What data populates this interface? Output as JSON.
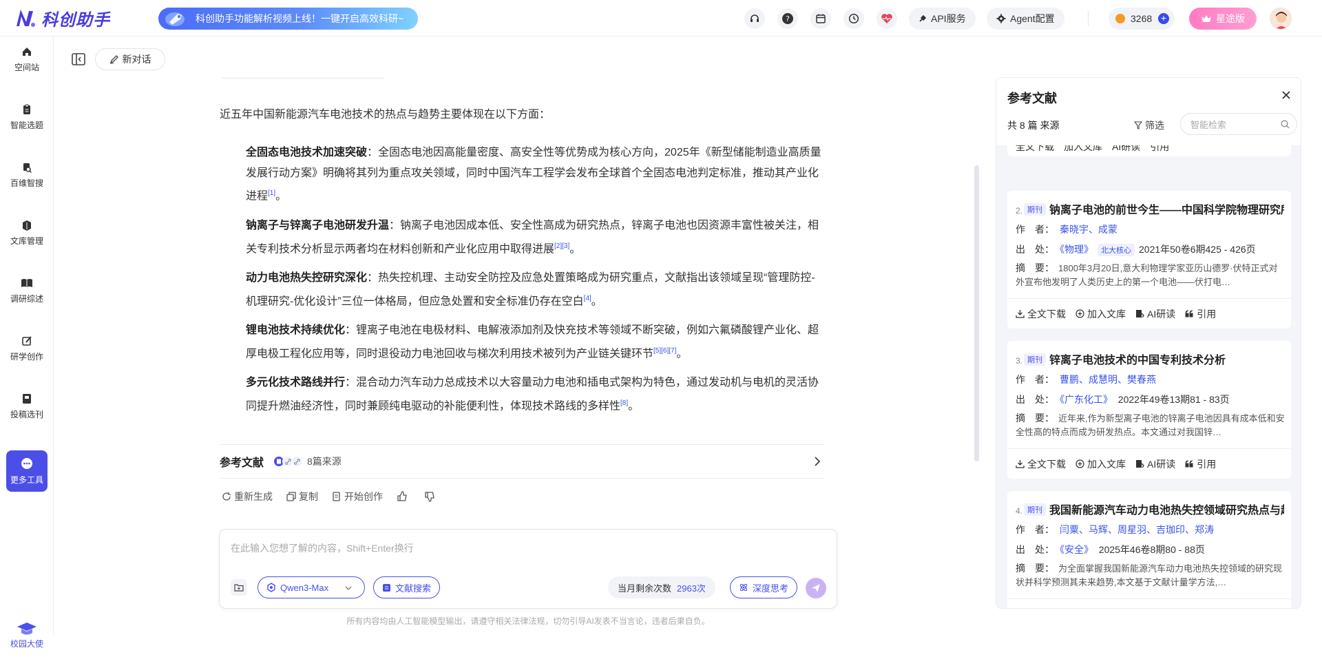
{
  "app": {
    "name": "科创助手"
  },
  "banner": {
    "text": "科创助手功能解析视频上线！一键开启高效科研~"
  },
  "header": {
    "api_label": "API服务",
    "agent_label": "Agent配置",
    "coins": "3268",
    "vip_label": "星途版",
    "plus_label": "+"
  },
  "sidebar": {
    "items": [
      {
        "label": "空间站",
        "icon": "home-icon"
      },
      {
        "label": "智能选题",
        "icon": "clipboard-icon"
      },
      {
        "label": "百维智搜",
        "icon": "search-icon"
      },
      {
        "label": "文库管理",
        "icon": "library-icon"
      },
      {
        "label": "调研综述",
        "icon": "book-icon"
      },
      {
        "label": "研学创作",
        "icon": "edit-icon"
      },
      {
        "label": "投稿选刊",
        "icon": "journal-icon"
      },
      {
        "label": "更多工具",
        "icon": "more-icon"
      }
    ],
    "bottom_label": "校园大使"
  },
  "chat": {
    "new_chat": "新对话",
    "intro": "近五年中国新能源汽车电池技术的热点与趋势主要体现在以下方面：",
    "points": [
      {
        "title": "全固态电池技术加速突破",
        "text": "：全固态电池因高能量密度、高安全性等优势成为核心方向，2025年《新型储能制造业高质量发展行动方案》明确将其列为重点攻关领域，同时中国汽车工程学会发布全球首个全固态电池判定标准，推动其产业化进程",
        "refs": "[1]",
        "end": "。"
      },
      {
        "title": "钠离子与锌离子电池研发升温",
        "text": "：钠离子电池因成本低、安全性高成为研究热点，锌离子电池也因资源丰富性被关注，相关专利技术分析显示两者均在材料创新和产业化应用中取得进展",
        "refs": "[2][3]",
        "end": "。"
      },
      {
        "title": "动力电池热失控研究深化",
        "text": "：热失控机理、主动安全防控及应急处置策略成为研究重点，文献指出该领域呈现“管理防控-机理研究-优化设计”三位一体格局，但应急处置和安全标准仍存在空白",
        "refs": "[4]",
        "end": "。"
      },
      {
        "title": "锂电池技术持续优化",
        "text": "：锂离子电池在电极材料、电解液添加剂及快充技术等领域不断突破，例如六氟磷酸锂产业化、超厚电极工程化应用等，同时退役动力电池回收与梯次利用技术被列为产业链关键环节",
        "refs": "[5][6][7]",
        "end": "。"
      },
      {
        "title": "多元化技术路线并行",
        "text": "：混合动力汽车动力总成技术以大容量动力电池和插电式架构为特色，通过发动机与电机的灵活协同提升燃油经济性，同时兼顾纯电驱动的补能便利性，体现技术路线的多样性",
        "refs": "[8]",
        "end": "。"
      }
    ],
    "ref_title": "参考文献",
    "ref_count": "8篇来源",
    "actions": {
      "regen": "重新生成",
      "copy": "复制",
      "create": "开始创作"
    }
  },
  "input": {
    "placeholder": "在此输入您想了解的内容，Shift+Enter换行",
    "model": "Qwen3-Max",
    "lit_search": "文献搜索",
    "remaining_label": "当月剩余次数",
    "remaining_value": "2963次",
    "deep_think": "深度思考",
    "disclaimer": "所有内容均由人工智能模型输出，请遵守相关法律法规，切勿引导AI发表不当言论，违者后果自负。"
  },
  "panel": {
    "title": "参考文献",
    "summary": "共 8 篇 来源",
    "filter": "筛选",
    "search_placeholder": "智能检索",
    "labels": {
      "author": "作　者：",
      "source": "出　处：",
      "abstract": "摘　要："
    },
    "actions": {
      "download": "全文下载",
      "add": "加入文库",
      "ai": "AI研读",
      "cite": "引用"
    },
    "cards": [
      {
        "num": "2.",
        "tag": "期刊",
        "title": "钠离子电池的前世今生——中国科学院物理研究所…",
        "authors": "秦晓宇、成蒙",
        "journal": "《物理》",
        "core": "北大核心",
        "issue": "2021年50卷6期425 - 426页",
        "abstract": "1800年3月20日,意大利物理学家亚历山德罗·伏特正式对外宣布他发明了人类历史上的第一个电池——伏打电…"
      },
      {
        "num": "3.",
        "tag": "期刊",
        "title": "锌离子电池技术的中国专利技术分析",
        "authors": "曹鹏、成慧明、樊春燕",
        "journal": "《广东化工》",
        "core": "",
        "issue": "2022年49卷13期81 - 83页",
        "abstract": "近年来,作为新型离子电池的锌离子电池因具有成本低和安全性高的特点而成为研发热点。本文通过对我国锌…"
      },
      {
        "num": "4.",
        "tag": "期刊",
        "title": "我国新能源汽车动力电池热失控领域研究热点与趋势…",
        "authors": "闫粟、马辉、周星羽、吉珈印、郑涛",
        "journal": "《安全》",
        "core": "",
        "issue": "2025年46卷8期80 - 88页",
        "abstract": "为全面掌握我国新能源汽车动力电池热失控领域的研究现状并科学预测其未来趋势,本文基于文献计量学方法,…"
      }
    ]
  }
}
